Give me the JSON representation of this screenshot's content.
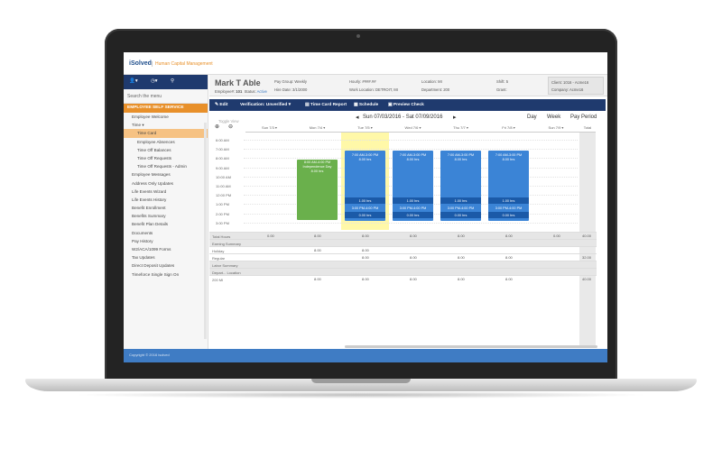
{
  "brand": {
    "logo": "iSolved",
    "subtitle": "Human Capital Management"
  },
  "employee": {
    "name": "Mark T Able",
    "employee_label": "Employee#:",
    "employee_no": "101",
    "status_label": "Status:",
    "status": "Active",
    "pay_group": "Pay Group: Weekly",
    "hire_date": "Hire Date: 3/1/2000",
    "hourly": "Hourly: ####.##",
    "work_location": "Work Location: DETROIT, MI",
    "location": "Location: MI",
    "department": "Department: 200",
    "shift": "Shift: 5",
    "grant": "Grant:",
    "client": "Client: 1016 - Acme16",
    "company": "Company: Acme16"
  },
  "sidebar": {
    "search_placeholder": "Search the menu",
    "section": "EMPLOYEE SELF SERVICE",
    "items": [
      {
        "label": "Employee Welcome",
        "sub": false,
        "active": false
      },
      {
        "label": "Time ▾",
        "sub": false,
        "active": false
      },
      {
        "label": "Time Card",
        "sub": true,
        "active": true
      },
      {
        "label": "Employee Absences",
        "sub": true,
        "active": false
      },
      {
        "label": "Time Off Balances",
        "sub": true,
        "active": false
      },
      {
        "label": "Time Off Requests",
        "sub": true,
        "active": false
      },
      {
        "label": "Time Off Requests - Admin",
        "sub": true,
        "active": false
      },
      {
        "label": "Employee Messages",
        "sub": false,
        "active": false
      },
      {
        "label": "Address Only Updates",
        "sub": false,
        "active": false
      },
      {
        "label": "Life Events Wizard",
        "sub": false,
        "active": false
      },
      {
        "label": "Life Events History",
        "sub": false,
        "active": false
      },
      {
        "label": "Benefit Enrollment",
        "sub": false,
        "active": false
      },
      {
        "label": "Benefits Summary",
        "sub": false,
        "active": false
      },
      {
        "label": "Benefit Plan Details",
        "sub": false,
        "active": false
      },
      {
        "label": "Documents",
        "sub": false,
        "active": false
      },
      {
        "label": "Pay History",
        "sub": false,
        "active": false
      },
      {
        "label": "W2/ACA/1099 Forms",
        "sub": false,
        "active": false
      },
      {
        "label": "Tax Updates",
        "sub": false,
        "active": false
      },
      {
        "label": "Direct Deposit Updates",
        "sub": false,
        "active": false
      },
      {
        "label": "Timeforce Single Sign On",
        "sub": false,
        "active": false
      }
    ]
  },
  "toolbar": {
    "edit": "Edit",
    "verification": "Verification: Unverified ▾",
    "time_card_report": "Time Card Report",
    "schedule": "Schedule",
    "preview_check": "Preview Check"
  },
  "datenav": {
    "range": "Sun 07/03/2016 - Sat 07/09/2016",
    "day": "Day",
    "week": "Week",
    "pay_period": "Pay Period",
    "toggle_view": "Toggle View"
  },
  "grid": {
    "columns": [
      "Sun 7/3 ▾",
      "Mon 7/4 ▾",
      "Tue 7/5 ▾",
      "Wed 7/6 ▾",
      "Thu 7/7 ▾",
      "Fri 7/8 ▾",
      "Sun 7/9 ▾",
      "Total"
    ],
    "times": [
      "6:00 AM",
      "7:00 AM",
      "8:00 AM",
      "9:00 AM",
      "10:00 AM",
      "11:00 AM",
      "12:00 PM",
      "1:00 PM",
      "2:00 PM",
      "3:00 PM"
    ],
    "holiday": {
      "time": "8:00 AM-4:00 PM",
      "name": "Independence Day",
      "hours": "8.00 hrs"
    },
    "work": {
      "time": "7:00 AM-3:00 PM",
      "hours": "8.00 hrs",
      "break_hours": "1.00 hrs",
      "late_time": "3:00 PM-4:00 PM",
      "late_hours": "0.00 hrs"
    },
    "summary_labels": [
      "Total Hours",
      "Earning Summary",
      "Holiday",
      "Regular",
      "Labor Summary",
      "Depart...   Location",
      "200     MI"
    ],
    "total_hours": [
      "0.00",
      "8.00",
      "8.00",
      "8.00",
      "8.00",
      "8.00",
      "0.00",
      "40.00"
    ],
    "holiday_hours": [
      "8.00",
      "8.00"
    ],
    "regular_hours": [
      "8.00",
      "8.00",
      "8.00",
      "8.00",
      "32.00"
    ],
    "labor_hours": [
      "8.00",
      "8.00",
      "8.00",
      "8.00",
      "8.00",
      "40.00"
    ]
  },
  "footer": {
    "text": "Copyright © 2016 isolved"
  }
}
